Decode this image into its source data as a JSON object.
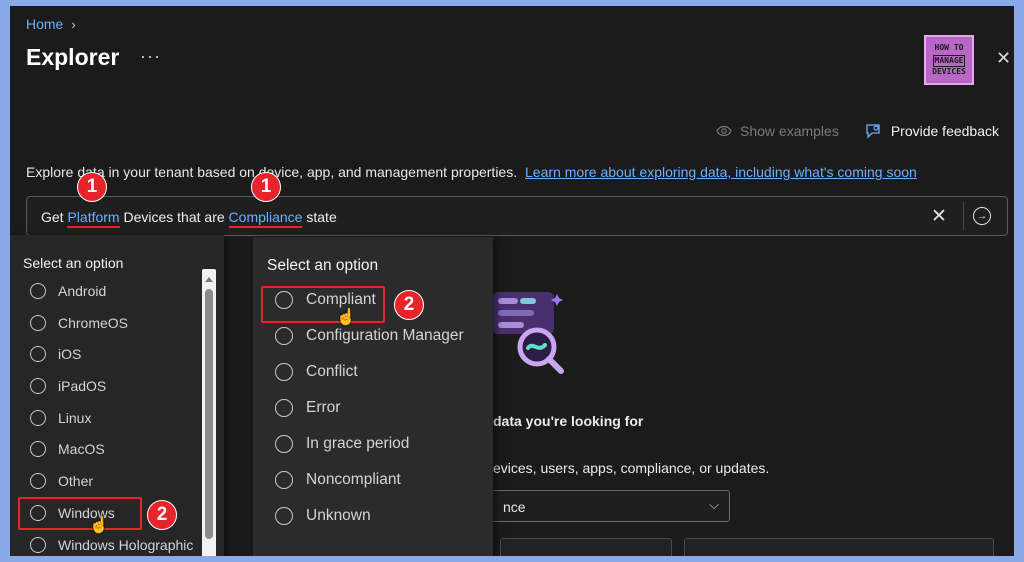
{
  "breadcrumb": {
    "home": "Home",
    "separator": "›"
  },
  "page": {
    "title": "Explorer",
    "more": "···"
  },
  "logo": {
    "line1": "HOW TO",
    "line2": "MANAGE",
    "line3": "DEVICES"
  },
  "toolbar": {
    "show_examples": "Show examples",
    "provide_feedback": "Provide feedback"
  },
  "description": {
    "text": "Explore data in your tenant based on device, app, and management properties.",
    "link": "Learn more about exploring data, including what's coming soon"
  },
  "query": {
    "get": "Get",
    "platform": "Platform",
    "devices_that_are": "Devices that are",
    "compliance": "Compliance",
    "state": "state"
  },
  "annotations": {
    "one": "1",
    "two": "2"
  },
  "left_panel": {
    "heading": "Select an option",
    "options": [
      "Android",
      "ChromeOS",
      "iOS",
      "iPadOS",
      "Linux",
      "MacOS",
      "Other",
      "Windows",
      "Windows Holographic"
    ]
  },
  "right_panel": {
    "heading": "Select an option",
    "options": [
      "Compliant",
      "Configuration Manager",
      "Conflict",
      "Error",
      "In grace period",
      "Noncompliant",
      "Unknown"
    ]
  },
  "background": {
    "heading_fragment": "data you're looking for",
    "subtext_fragment": "evices, users, apps, compliance, or updates.",
    "select_value": "nce"
  },
  "colors": {
    "accent": "#6cb0ff",
    "annotation_red": "#e5252a",
    "background": "#1b1b1b"
  },
  "icons": [
    "chevron-right-icon",
    "close-icon",
    "eye-icon",
    "feedback-icon",
    "arrow-right-circle-icon",
    "chevron-down-icon",
    "hand-cursor-icon"
  ]
}
